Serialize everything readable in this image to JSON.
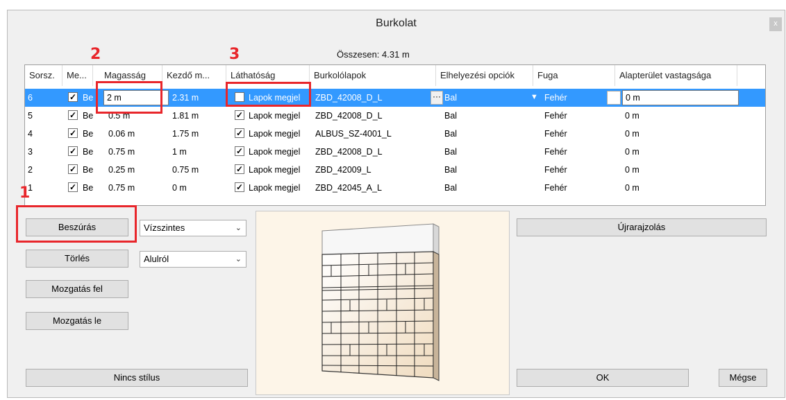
{
  "window": {
    "title": "Burkolat",
    "close_icon": "x"
  },
  "summary": {
    "total": "Összesen: 4.31 m"
  },
  "grid": {
    "headers": [
      "Sorsz.",
      "Me...",
      "Magasság",
      "Kezdő m...",
      "Láthatóság",
      "Burkolólapok",
      "Elhelyezési opciók",
      "Fuga",
      "Alapterület vastagsága"
    ],
    "rows": [
      {
        "num": "6",
        "me_checked": true,
        "me": "Be",
        "height": "2 m",
        "start": "2.31 m",
        "vis_checked": false,
        "vis": "Lapok megjel",
        "tile": "ZBD_42008_D_L",
        "placement": "Bal",
        "joint": "Fehér",
        "thickness": "0 m",
        "selected": true
      },
      {
        "num": "5",
        "me_checked": true,
        "me": "Be",
        "height": "0.5 m",
        "start": "1.81 m",
        "vis_checked": true,
        "vis": "Lapok megjel",
        "tile": "ZBD_42008_D_L",
        "placement": "Bal",
        "joint": "Fehér",
        "thickness": "0 m"
      },
      {
        "num": "4",
        "me_checked": true,
        "me": "Be",
        "height": "0.06 m",
        "start": "1.75 m",
        "vis_checked": true,
        "vis": "Lapok megjel",
        "tile": "ALBUS_SZ-4001_L",
        "placement": "Bal",
        "joint": "Fehér",
        "thickness": "0 m"
      },
      {
        "num": "3",
        "me_checked": true,
        "me": "Be",
        "height": "0.75 m",
        "start": "1 m",
        "vis_checked": true,
        "vis": "Lapok megjel",
        "tile": "ZBD_42008_D_L",
        "placement": "Bal",
        "joint": "Fehér",
        "thickness": "0 m"
      },
      {
        "num": "2",
        "me_checked": true,
        "me": "Be",
        "height": "0.25 m",
        "start": "0.75 m",
        "vis_checked": true,
        "vis": "Lapok megjel",
        "tile": "ZBD_42009_L",
        "placement": "Bal",
        "joint": "Fehér",
        "thickness": "0 m"
      },
      {
        "num": "1",
        "me_checked": true,
        "me": "Be",
        "height": "0.75 m",
        "start": "0 m",
        "vis_checked": true,
        "vis": "Lapok megjel",
        "tile": "ZBD_42045_A_L",
        "placement": "Bal",
        "joint": "Fehér",
        "thickness": "0 m"
      }
    ]
  },
  "buttons": {
    "insert": "Beszúrás",
    "delete": "Törlés",
    "move_up": "Mozgatás fel",
    "move_down": "Mozgatás le",
    "no_style": "Nincs stílus",
    "redraw": "Újrarajzolás",
    "ok": "OK",
    "cancel": "Mégse"
  },
  "selects": {
    "orientation": "Vízszintes",
    "direction": "Alulról"
  },
  "annotations": {
    "one": "1",
    "two": "2",
    "three": "3"
  },
  "colors": {
    "selection": "#3399ff",
    "annotation": "#e8262b"
  }
}
